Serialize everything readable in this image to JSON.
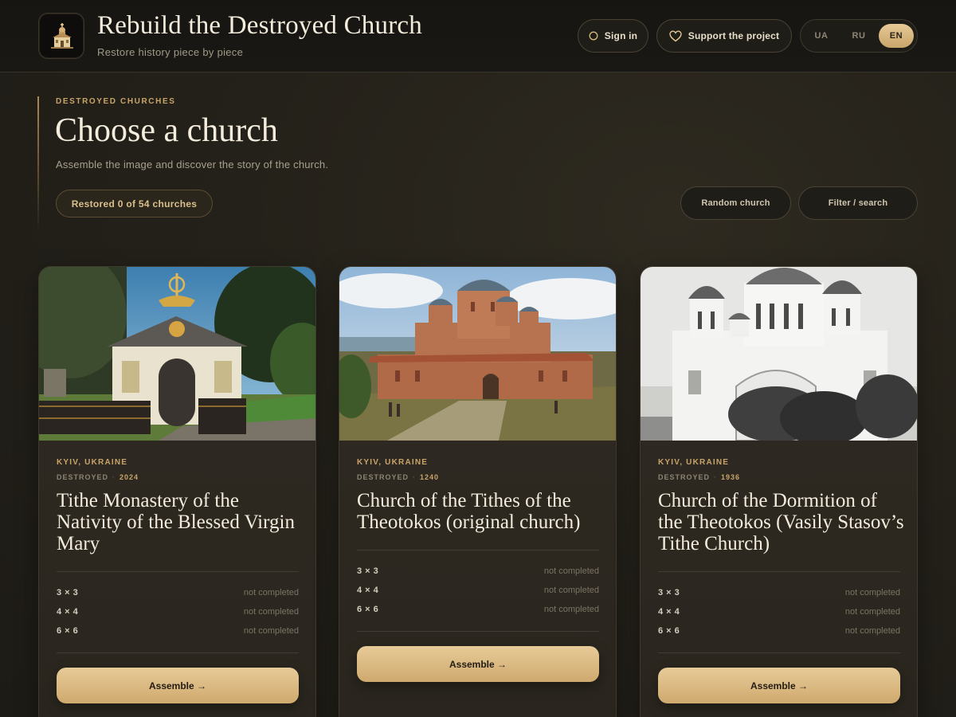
{
  "header": {
    "title": "Rebuild the Destroyed Church",
    "subtitle": "Restore history piece by piece",
    "signin_label": "Sign in",
    "support_label": "Support the project",
    "languages": [
      "UA",
      "RU",
      "EN"
    ],
    "active_language": "EN"
  },
  "hero": {
    "eyebrow": "DESTROYED CHURCHES",
    "title": "Choose a church",
    "description": "Assemble the image and discover the story of the church.",
    "progress": "Restored 0 of 54 churches",
    "random_label": "Random church",
    "filter_label": "Filter / search"
  },
  "cards": [
    {
      "location": "KYIV, UKRAINE",
      "destroyed_label": "DESTROYED",
      "year": "2024",
      "title": "Tithe Monastery of the Nativity of the Blessed Virgin Mary",
      "levels": [
        {
          "size": "3 × 3",
          "status": "not completed"
        },
        {
          "size": "4 × 4",
          "status": "not completed"
        },
        {
          "size": "6 × 6",
          "status": "not completed"
        }
      ],
      "button": "Assemble →"
    },
    {
      "location": "KYIV, UKRAINE",
      "destroyed_label": "DESTROYED",
      "year": "1240",
      "title": "Church of the Tithes of the Theotokos (original church)",
      "levels": [
        {
          "size": "3 × 3",
          "status": "not completed"
        },
        {
          "size": "4 × 4",
          "status": "not completed"
        },
        {
          "size": "6 × 6",
          "status": "not completed"
        }
      ],
      "button": "Assemble →"
    },
    {
      "location": "KYIV, UKRAINE",
      "destroyed_label": "DESTROYED",
      "year": "1936",
      "title": "Church of the Dormition of the Theotokos (Vasily Stasov’s Tithe Church)",
      "levels": [
        {
          "size": "3 × 3",
          "status": "not completed"
        },
        {
          "size": "4 × 4",
          "status": "not completed"
        },
        {
          "size": "6 × 6",
          "status": "not completed"
        }
      ],
      "button": "Assemble →"
    }
  ],
  "colors": {
    "accent": "#c9a46a",
    "button_gold": "#e3c48f",
    "background": "#24211a"
  },
  "icons": {
    "logo": "church-icon",
    "signin": "circle-icon",
    "support": "heart-icon"
  }
}
